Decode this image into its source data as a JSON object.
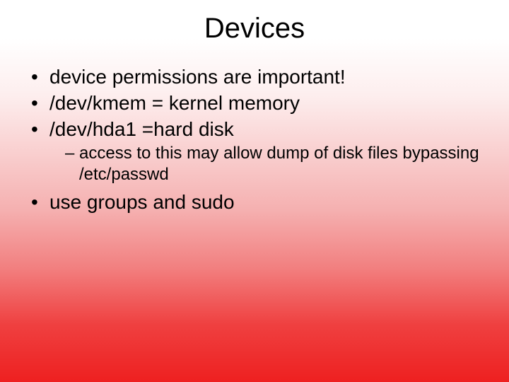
{
  "title": "Devices",
  "bullets": {
    "b0": "device permissions are important!",
    "b1": "/dev/kmem = kernel memory",
    "b2": "/dev/hda1 =hard disk",
    "b2_sub0": "access to this may allow dump of disk files bypassing   /etc/passwd",
    "b3": "use groups and sudo"
  }
}
